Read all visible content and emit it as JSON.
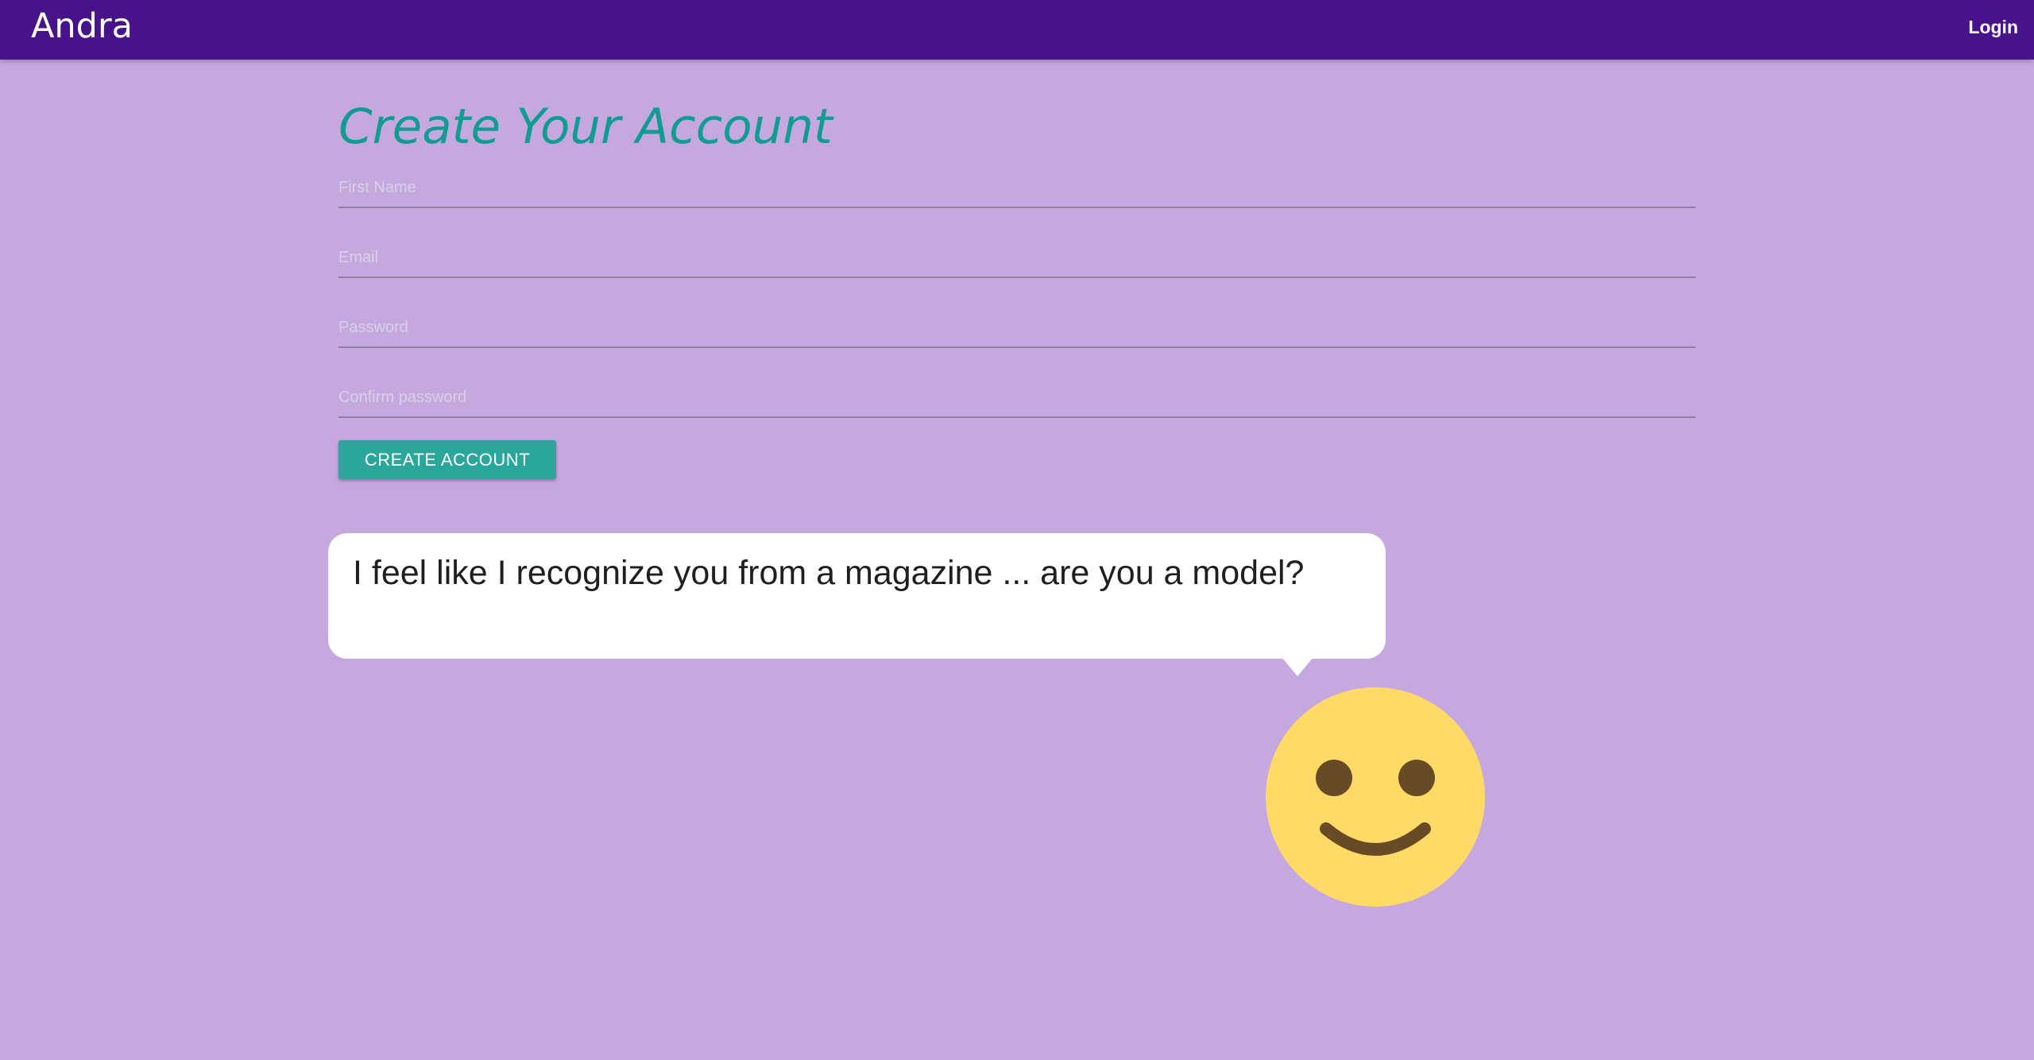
{
  "header": {
    "brand": "Andra",
    "login_label": "Login"
  },
  "form": {
    "title": "Create Your Account",
    "fields": [
      {
        "placeholder": "First Name",
        "value": ""
      },
      {
        "placeholder": "Email",
        "value": ""
      },
      {
        "placeholder": "Password",
        "value": ""
      },
      {
        "placeholder": "Confirm password",
        "value": ""
      }
    ],
    "submit_label": "CREATE ACCOUNT"
  },
  "chat": {
    "message": "I feel like I recognize you from a magazine ... are you a model?",
    "avatar_icon": "smiley-face-icon"
  },
  "colors": {
    "background": "#c5a8e0",
    "header": "#48138a",
    "title": "#119c93",
    "button": "#2aa79a",
    "smiley": "#ffda66",
    "smiley_features": "#664b24"
  }
}
